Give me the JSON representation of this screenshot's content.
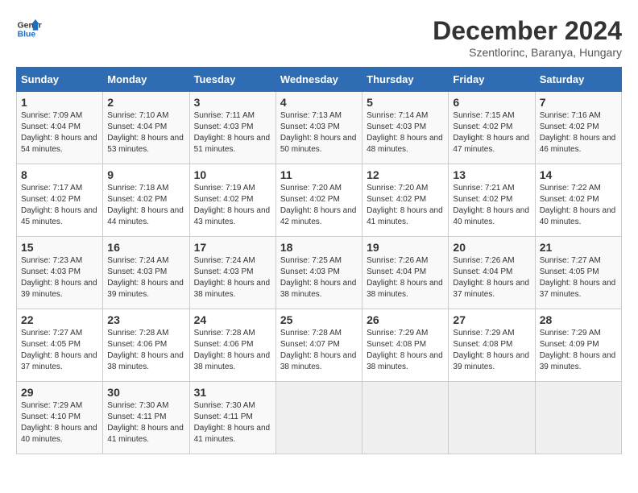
{
  "logo": {
    "line1": "General",
    "line2": "Blue"
  },
  "title": "December 2024",
  "subtitle": "Szentlorinc, Baranya, Hungary",
  "days_of_week": [
    "Sunday",
    "Monday",
    "Tuesday",
    "Wednesday",
    "Thursday",
    "Friday",
    "Saturday"
  ],
  "weeks": [
    [
      {
        "day": "1",
        "sunrise": "7:09 AM",
        "sunset": "4:04 PM",
        "daylight": "8 hours and 54 minutes."
      },
      {
        "day": "2",
        "sunrise": "7:10 AM",
        "sunset": "4:04 PM",
        "daylight": "8 hours and 53 minutes."
      },
      {
        "day": "3",
        "sunrise": "7:11 AM",
        "sunset": "4:03 PM",
        "daylight": "8 hours and 51 minutes."
      },
      {
        "day": "4",
        "sunrise": "7:13 AM",
        "sunset": "4:03 PM",
        "daylight": "8 hours and 50 minutes."
      },
      {
        "day": "5",
        "sunrise": "7:14 AM",
        "sunset": "4:03 PM",
        "daylight": "8 hours and 48 minutes."
      },
      {
        "day": "6",
        "sunrise": "7:15 AM",
        "sunset": "4:02 PM",
        "daylight": "8 hours and 47 minutes."
      },
      {
        "day": "7",
        "sunrise": "7:16 AM",
        "sunset": "4:02 PM",
        "daylight": "8 hours and 46 minutes."
      }
    ],
    [
      {
        "day": "8",
        "sunrise": "7:17 AM",
        "sunset": "4:02 PM",
        "daylight": "8 hours and 45 minutes."
      },
      {
        "day": "9",
        "sunrise": "7:18 AM",
        "sunset": "4:02 PM",
        "daylight": "8 hours and 44 minutes."
      },
      {
        "day": "10",
        "sunrise": "7:19 AM",
        "sunset": "4:02 PM",
        "daylight": "8 hours and 43 minutes."
      },
      {
        "day": "11",
        "sunrise": "7:20 AM",
        "sunset": "4:02 PM",
        "daylight": "8 hours and 42 minutes."
      },
      {
        "day": "12",
        "sunrise": "7:20 AM",
        "sunset": "4:02 PM",
        "daylight": "8 hours and 41 minutes."
      },
      {
        "day": "13",
        "sunrise": "7:21 AM",
        "sunset": "4:02 PM",
        "daylight": "8 hours and 40 minutes."
      },
      {
        "day": "14",
        "sunrise": "7:22 AM",
        "sunset": "4:02 PM",
        "daylight": "8 hours and 40 minutes."
      }
    ],
    [
      {
        "day": "15",
        "sunrise": "7:23 AM",
        "sunset": "4:03 PM",
        "daylight": "8 hours and 39 minutes."
      },
      {
        "day": "16",
        "sunrise": "7:24 AM",
        "sunset": "4:03 PM",
        "daylight": "8 hours and 39 minutes."
      },
      {
        "day": "17",
        "sunrise": "7:24 AM",
        "sunset": "4:03 PM",
        "daylight": "8 hours and 38 minutes."
      },
      {
        "day": "18",
        "sunrise": "7:25 AM",
        "sunset": "4:03 PM",
        "daylight": "8 hours and 38 minutes."
      },
      {
        "day": "19",
        "sunrise": "7:26 AM",
        "sunset": "4:04 PM",
        "daylight": "8 hours and 38 minutes."
      },
      {
        "day": "20",
        "sunrise": "7:26 AM",
        "sunset": "4:04 PM",
        "daylight": "8 hours and 37 minutes."
      },
      {
        "day": "21",
        "sunrise": "7:27 AM",
        "sunset": "4:05 PM",
        "daylight": "8 hours and 37 minutes."
      }
    ],
    [
      {
        "day": "22",
        "sunrise": "7:27 AM",
        "sunset": "4:05 PM",
        "daylight": "8 hours and 37 minutes."
      },
      {
        "day": "23",
        "sunrise": "7:28 AM",
        "sunset": "4:06 PM",
        "daylight": "8 hours and 38 minutes."
      },
      {
        "day": "24",
        "sunrise": "7:28 AM",
        "sunset": "4:06 PM",
        "daylight": "8 hours and 38 minutes."
      },
      {
        "day": "25",
        "sunrise": "7:28 AM",
        "sunset": "4:07 PM",
        "daylight": "8 hours and 38 minutes."
      },
      {
        "day": "26",
        "sunrise": "7:29 AM",
        "sunset": "4:08 PM",
        "daylight": "8 hours and 38 minutes."
      },
      {
        "day": "27",
        "sunrise": "7:29 AM",
        "sunset": "4:08 PM",
        "daylight": "8 hours and 39 minutes."
      },
      {
        "day": "28",
        "sunrise": "7:29 AM",
        "sunset": "4:09 PM",
        "daylight": "8 hours and 39 minutes."
      }
    ],
    [
      {
        "day": "29",
        "sunrise": "7:29 AM",
        "sunset": "4:10 PM",
        "daylight": "8 hours and 40 minutes."
      },
      {
        "day": "30",
        "sunrise": "7:30 AM",
        "sunset": "4:11 PM",
        "daylight": "8 hours and 41 minutes."
      },
      {
        "day": "31",
        "sunrise": "7:30 AM",
        "sunset": "4:11 PM",
        "daylight": "8 hours and 41 minutes."
      },
      null,
      null,
      null,
      null
    ]
  ]
}
